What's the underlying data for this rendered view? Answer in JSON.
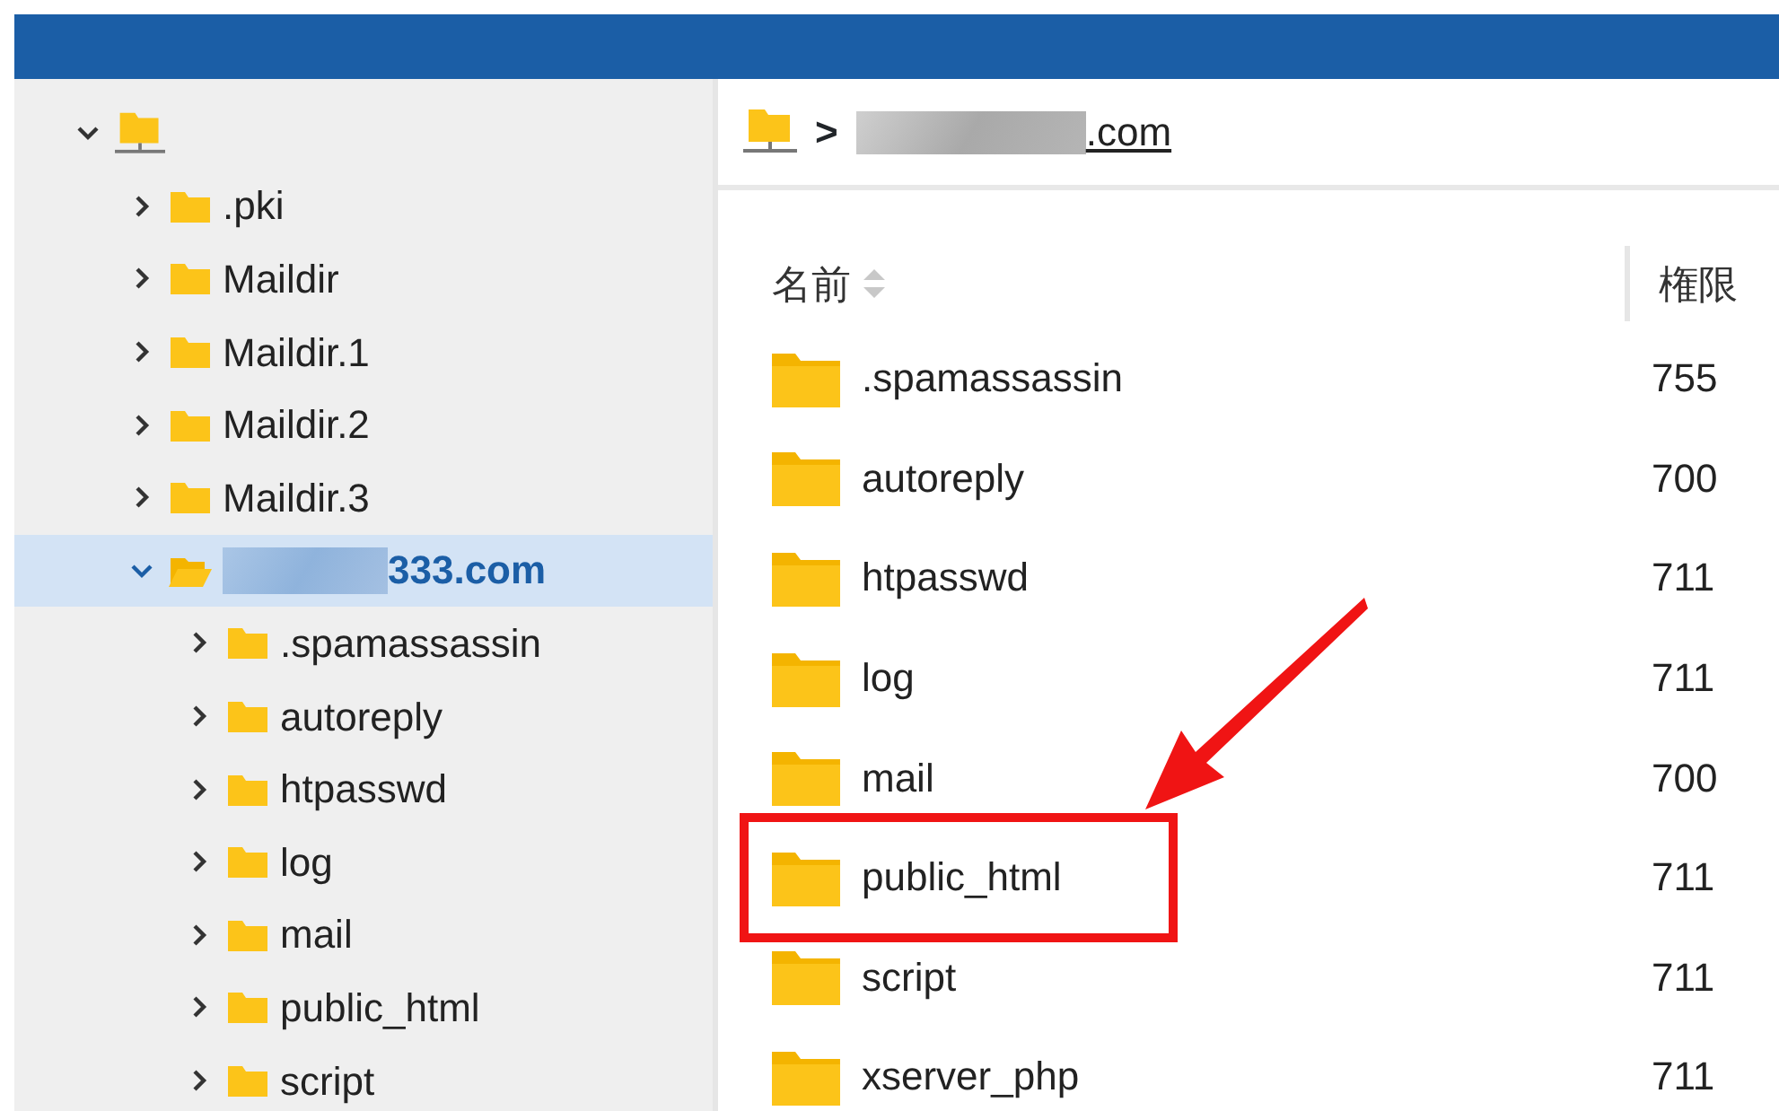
{
  "tree": {
    "expanded": true,
    "children": [
      {
        "label": ".pki",
        "expanded": false,
        "selected": false
      },
      {
        "label": "Maildir",
        "expanded": false,
        "selected": false
      },
      {
        "label": "Maildir.1",
        "expanded": false,
        "selected": false
      },
      {
        "label": "Maildir.2",
        "expanded": false,
        "selected": false
      },
      {
        "label": "Maildir.3",
        "expanded": false,
        "selected": false
      },
      {
        "label": "333.com",
        "expanded": true,
        "selected": true,
        "children": [
          {
            "label": ".spamassassin",
            "expanded": false,
            "selected": false
          },
          {
            "label": "autoreply",
            "expanded": false,
            "selected": false
          },
          {
            "label": "htpasswd",
            "expanded": false,
            "selected": false
          },
          {
            "label": "log",
            "expanded": false,
            "selected": false
          },
          {
            "label": "mail",
            "expanded": false,
            "selected": false
          },
          {
            "label": "public_html",
            "expanded": false,
            "selected": false
          },
          {
            "label": "script",
            "expanded": false,
            "selected": false
          }
        ]
      }
    ]
  },
  "breadcrumb": {
    "separator": ">",
    "current": ".com"
  },
  "table": {
    "columns": [
      "名前",
      "権限"
    ],
    "rows": [
      {
        "name": ".spamassassin",
        "permission": "755",
        "highlighted": false
      },
      {
        "name": "autoreply",
        "permission": "700",
        "highlighted": false
      },
      {
        "name": "htpasswd",
        "permission": "711",
        "highlighted": false
      },
      {
        "name": "log",
        "permission": "711",
        "highlighted": false
      },
      {
        "name": "mail",
        "permission": "700",
        "highlighted": false
      },
      {
        "name": "public_html",
        "permission": "711",
        "highlighted": true
      },
      {
        "name": "script",
        "permission": "711",
        "highlighted": false
      },
      {
        "name": "xserver_php",
        "permission": "711",
        "highlighted": false
      }
    ]
  }
}
